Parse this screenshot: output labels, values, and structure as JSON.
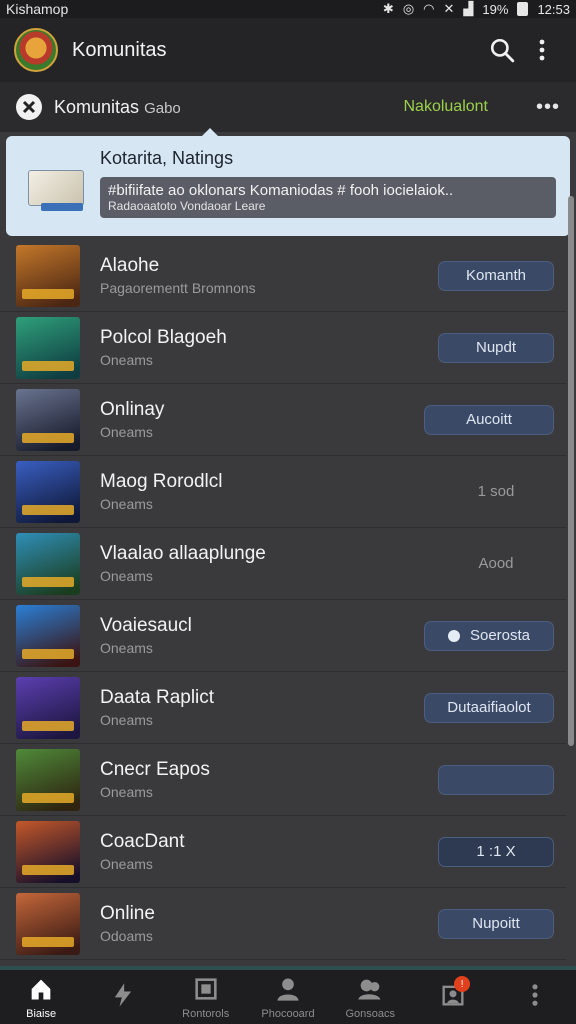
{
  "status_bar": {
    "carrier": "Kishamop",
    "battery": "19%",
    "time": "12:53"
  },
  "app_bar": {
    "title": "Komunitas"
  },
  "sub_header": {
    "title": "Komunitas",
    "title_suffix": "Gabo",
    "link": "Nakolualont"
  },
  "tooltip": {
    "title": "Kotarita, Natings",
    "line1": "#bifiifate ao oklonars Komaniodas # fooh iocielaiok..",
    "line2": "Radaoaatoto Vondaoar Leare"
  },
  "list": [
    {
      "title": "Alaohe",
      "subtitle": "Pagaorementt Bromnons",
      "button": "Komanth",
      "style": "primary",
      "art": [
        "#c4782a",
        "#4b2613"
      ]
    },
    {
      "title": "Polcol Blagoeh",
      "subtitle": "Oneams",
      "button": "Nupdt",
      "style": "primary",
      "art": [
        "#2fa07a",
        "#0f3d42"
      ]
    },
    {
      "title": "Onlinay",
      "subtitle": "Oneams",
      "button": "Aucoitt",
      "style": "wide",
      "art": [
        "#6a7490",
        "#171a2a"
      ]
    },
    {
      "title": "Maog Rorodlcl",
      "subtitle": "Oneams",
      "button": "1 sod",
      "style": "ghost",
      "art": [
        "#3a5fc2",
        "#0f1838"
      ]
    },
    {
      "title": "Vlaalao allaaplunge",
      "subtitle": "Oneams",
      "button": "Aood",
      "style": "ghost",
      "art": [
        "#2f8fb8",
        "#1b3d1f"
      ]
    },
    {
      "title": "Voaiesaucl",
      "subtitle": "Oneams",
      "button": "Soerosta",
      "style": "wide-dot",
      "art": [
        "#2b7fd6",
        "#3a1412"
      ]
    },
    {
      "title": "Daata Raplict",
      "subtitle": "Oneams",
      "button": "Dutaaifiaolot",
      "style": "wide",
      "art": [
        "#5b3fb0",
        "#1d1640"
      ]
    },
    {
      "title": "Cnecr Eapos",
      "subtitle": "Oneams",
      "button": "",
      "style": "primary",
      "art": [
        "#4f8a3a",
        "#2e2410"
      ]
    },
    {
      "title": "CoacDant",
      "subtitle": "Oneams",
      "button": "1 :1 X",
      "style": "primary-dark",
      "art": [
        "#c4582a",
        "#160f2a"
      ]
    },
    {
      "title": "Online",
      "subtitle": "Odoams",
      "button": "Nupoitt",
      "style": "primary",
      "art": [
        "#c4673a",
        "#3a1a14"
      ]
    }
  ],
  "bottom_nav": [
    {
      "label": "Biaise",
      "icon": "home-icon",
      "active": true
    },
    {
      "label": "",
      "icon": "lightning-icon",
      "active": false
    },
    {
      "label": "Rontorols",
      "icon": "square-icon",
      "active": false
    },
    {
      "label": "Phocooard",
      "icon": "person-icon",
      "active": false
    },
    {
      "label": "Gonsoacs",
      "icon": "group-icon",
      "active": false
    },
    {
      "label": "",
      "icon": "profile-icon",
      "active": false,
      "badge": "!"
    },
    {
      "label": "",
      "icon": "more-icon",
      "active": false
    }
  ]
}
